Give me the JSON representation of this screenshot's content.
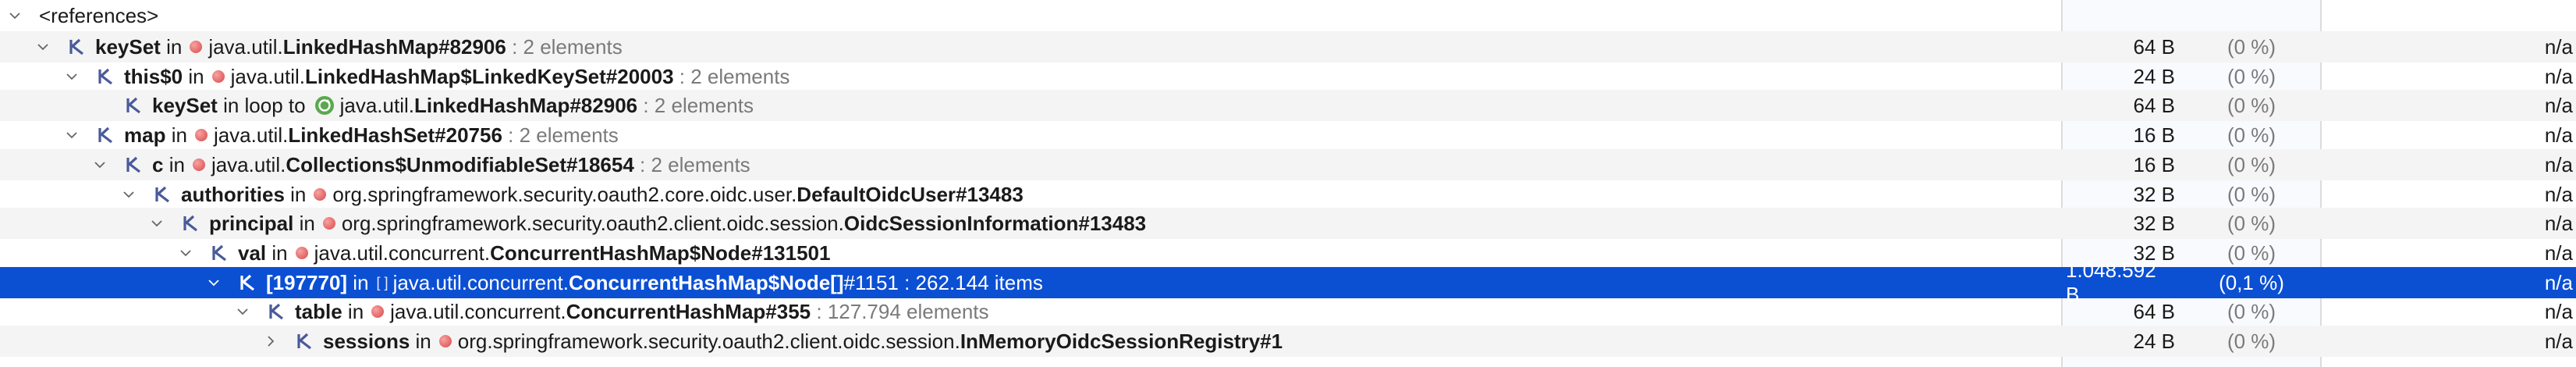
{
  "root_label": "<references>",
  "rows": [
    {
      "depth": 1,
      "expanded": true,
      "name": "keySet",
      "in": "in",
      "pkg": "java.util.",
      "cls": "LinkedHashMap#82906",
      "extra": " : 2 elements",
      "size": "64 B",
      "pct": "(0 %)",
      "na": "n/a",
      "icon": "dot"
    },
    {
      "depth": 2,
      "expanded": true,
      "name": "this$0",
      "in": "in",
      "pkg": "java.util.",
      "cls": "LinkedHashMap$LinkedKeySet#20003",
      "extra": " : 2 elements",
      "size": "24 B",
      "pct": "(0 %)",
      "na": "n/a",
      "icon": "dot"
    },
    {
      "depth": 3,
      "expanded": null,
      "name": "keySet",
      "in": "in loop to",
      "pkg": "java.util.",
      "cls": "LinkedHashMap#82906",
      "extra": " : 2 elements",
      "size": "64 B",
      "pct": "(0 %)",
      "na": "n/a",
      "icon": "loop"
    },
    {
      "depth": 2,
      "expanded": true,
      "name": "map",
      "in": "in",
      "pkg": "java.util.",
      "cls": "LinkedHashSet#20756",
      "extra": " : 2 elements",
      "size": "16 B",
      "pct": "(0 %)",
      "na": "n/a",
      "icon": "dot"
    },
    {
      "depth": 3,
      "expanded": true,
      "name": "c",
      "in": "in",
      "pkg": "java.util.",
      "cls": "Collections$UnmodifiableSet#18654",
      "extra": " : 2 elements",
      "size": "16 B",
      "pct": "(0 %)",
      "na": "n/a",
      "icon": "dot"
    },
    {
      "depth": 4,
      "expanded": true,
      "name": "authorities",
      "in": "in",
      "pkg": "org.springframework.security.oauth2.core.oidc.user.",
      "cls": "DefaultOidcUser#13483",
      "extra": "",
      "size": "32 B",
      "pct": "(0 %)",
      "na": "n/a",
      "icon": "dot"
    },
    {
      "depth": 5,
      "expanded": true,
      "name": "principal",
      "in": "in",
      "pkg": "org.springframework.security.oauth2.client.oidc.session.",
      "cls": "OidcSessionInformation#13483",
      "extra": "",
      "size": "32 B",
      "pct": "(0 %)",
      "na": "n/a",
      "icon": "dot"
    },
    {
      "depth": 6,
      "expanded": true,
      "name": "val",
      "in": "in",
      "pkg": "java.util.concurrent.",
      "cls": "ConcurrentHashMap$Node#131501",
      "extra": "",
      "size": "32 B",
      "pct": "(0 %)",
      "na": "n/a",
      "icon": "dot"
    },
    {
      "depth": 7,
      "expanded": true,
      "name": "[197770]",
      "in": "in",
      "pkg": "java.util.concurrent.",
      "cls": "ConcurrentHashMap$Node[]",
      "cls2": "#1151",
      "extra": " : 262.144 items",
      "size": "1.048.592 B",
      "pct": "(0,1 %)",
      "na": "n/a",
      "icon": "array",
      "selected": true
    },
    {
      "depth": 8,
      "expanded": true,
      "name": "table",
      "in": "in",
      "pkg": "java.util.concurrent.",
      "cls": "ConcurrentHashMap#355",
      "extra": " : 127.794 elements",
      "size": "64 B",
      "pct": "(0 %)",
      "na": "n/a",
      "icon": "dot"
    },
    {
      "depth": 9,
      "expanded": false,
      "name": "sessions",
      "in": "in",
      "pkg": "org.springframework.security.oauth2.client.oidc.session.",
      "cls": "InMemoryOidcSessionRegistry#1",
      "extra": "",
      "size": "24 B",
      "pct": "(0 %)",
      "na": "n/a",
      "icon": "dot"
    }
  ],
  "colors": {
    "selection": "#0b4fd3",
    "ref_icon": "#4a5a9a",
    "dot": "#d84848"
  },
  "icons": {
    "expand": "chevron-down-icon",
    "collapse": "chevron-right-icon",
    "ref": "reference-icon",
    "object": "object-dot-icon",
    "loop": "loop-icon",
    "array": "array-icon"
  }
}
